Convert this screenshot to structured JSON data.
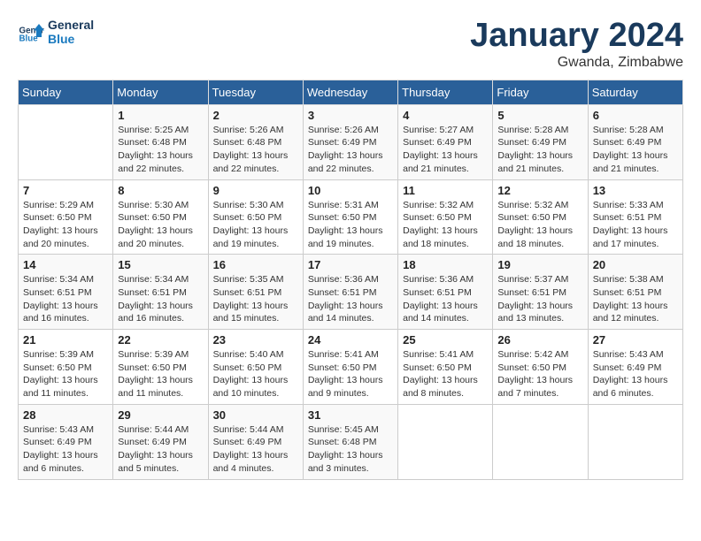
{
  "logo": {
    "line1": "General",
    "line2": "Blue"
  },
  "title": "January 2024",
  "subtitle": "Gwanda, Zimbabwe",
  "weekdays": [
    "Sunday",
    "Monday",
    "Tuesday",
    "Wednesday",
    "Thursday",
    "Friday",
    "Saturday"
  ],
  "weeks": [
    [
      {
        "day": "",
        "detail": ""
      },
      {
        "day": "1",
        "detail": "Sunrise: 5:25 AM\nSunset: 6:48 PM\nDaylight: 13 hours\nand 22 minutes."
      },
      {
        "day": "2",
        "detail": "Sunrise: 5:26 AM\nSunset: 6:48 PM\nDaylight: 13 hours\nand 22 minutes."
      },
      {
        "day": "3",
        "detail": "Sunrise: 5:26 AM\nSunset: 6:49 PM\nDaylight: 13 hours\nand 22 minutes."
      },
      {
        "day": "4",
        "detail": "Sunrise: 5:27 AM\nSunset: 6:49 PM\nDaylight: 13 hours\nand 21 minutes."
      },
      {
        "day": "5",
        "detail": "Sunrise: 5:28 AM\nSunset: 6:49 PM\nDaylight: 13 hours\nand 21 minutes."
      },
      {
        "day": "6",
        "detail": "Sunrise: 5:28 AM\nSunset: 6:49 PM\nDaylight: 13 hours\nand 21 minutes."
      }
    ],
    [
      {
        "day": "7",
        "detail": "Sunrise: 5:29 AM\nSunset: 6:50 PM\nDaylight: 13 hours\nand 20 minutes."
      },
      {
        "day": "8",
        "detail": "Sunrise: 5:30 AM\nSunset: 6:50 PM\nDaylight: 13 hours\nand 20 minutes."
      },
      {
        "day": "9",
        "detail": "Sunrise: 5:30 AM\nSunset: 6:50 PM\nDaylight: 13 hours\nand 19 minutes."
      },
      {
        "day": "10",
        "detail": "Sunrise: 5:31 AM\nSunset: 6:50 PM\nDaylight: 13 hours\nand 19 minutes."
      },
      {
        "day": "11",
        "detail": "Sunrise: 5:32 AM\nSunset: 6:50 PM\nDaylight: 13 hours\nand 18 minutes."
      },
      {
        "day": "12",
        "detail": "Sunrise: 5:32 AM\nSunset: 6:50 PM\nDaylight: 13 hours\nand 18 minutes."
      },
      {
        "day": "13",
        "detail": "Sunrise: 5:33 AM\nSunset: 6:51 PM\nDaylight: 13 hours\nand 17 minutes."
      }
    ],
    [
      {
        "day": "14",
        "detail": "Sunrise: 5:34 AM\nSunset: 6:51 PM\nDaylight: 13 hours\nand 16 minutes."
      },
      {
        "day": "15",
        "detail": "Sunrise: 5:34 AM\nSunset: 6:51 PM\nDaylight: 13 hours\nand 16 minutes."
      },
      {
        "day": "16",
        "detail": "Sunrise: 5:35 AM\nSunset: 6:51 PM\nDaylight: 13 hours\nand 15 minutes."
      },
      {
        "day": "17",
        "detail": "Sunrise: 5:36 AM\nSunset: 6:51 PM\nDaylight: 13 hours\nand 14 minutes."
      },
      {
        "day": "18",
        "detail": "Sunrise: 5:36 AM\nSunset: 6:51 PM\nDaylight: 13 hours\nand 14 minutes."
      },
      {
        "day": "19",
        "detail": "Sunrise: 5:37 AM\nSunset: 6:51 PM\nDaylight: 13 hours\nand 13 minutes."
      },
      {
        "day": "20",
        "detail": "Sunrise: 5:38 AM\nSunset: 6:51 PM\nDaylight: 13 hours\nand 12 minutes."
      }
    ],
    [
      {
        "day": "21",
        "detail": "Sunrise: 5:39 AM\nSunset: 6:50 PM\nDaylight: 13 hours\nand 11 minutes."
      },
      {
        "day": "22",
        "detail": "Sunrise: 5:39 AM\nSunset: 6:50 PM\nDaylight: 13 hours\nand 11 minutes."
      },
      {
        "day": "23",
        "detail": "Sunrise: 5:40 AM\nSunset: 6:50 PM\nDaylight: 13 hours\nand 10 minutes."
      },
      {
        "day": "24",
        "detail": "Sunrise: 5:41 AM\nSunset: 6:50 PM\nDaylight: 13 hours\nand 9 minutes."
      },
      {
        "day": "25",
        "detail": "Sunrise: 5:41 AM\nSunset: 6:50 PM\nDaylight: 13 hours\nand 8 minutes."
      },
      {
        "day": "26",
        "detail": "Sunrise: 5:42 AM\nSunset: 6:50 PM\nDaylight: 13 hours\nand 7 minutes."
      },
      {
        "day": "27",
        "detail": "Sunrise: 5:43 AM\nSunset: 6:49 PM\nDaylight: 13 hours\nand 6 minutes."
      }
    ],
    [
      {
        "day": "28",
        "detail": "Sunrise: 5:43 AM\nSunset: 6:49 PM\nDaylight: 13 hours\nand 6 minutes."
      },
      {
        "day": "29",
        "detail": "Sunrise: 5:44 AM\nSunset: 6:49 PM\nDaylight: 13 hours\nand 5 minutes."
      },
      {
        "day": "30",
        "detail": "Sunrise: 5:44 AM\nSunset: 6:49 PM\nDaylight: 13 hours\nand 4 minutes."
      },
      {
        "day": "31",
        "detail": "Sunrise: 5:45 AM\nSunset: 6:48 PM\nDaylight: 13 hours\nand 3 minutes."
      },
      {
        "day": "",
        "detail": ""
      },
      {
        "day": "",
        "detail": ""
      },
      {
        "day": "",
        "detail": ""
      }
    ]
  ]
}
